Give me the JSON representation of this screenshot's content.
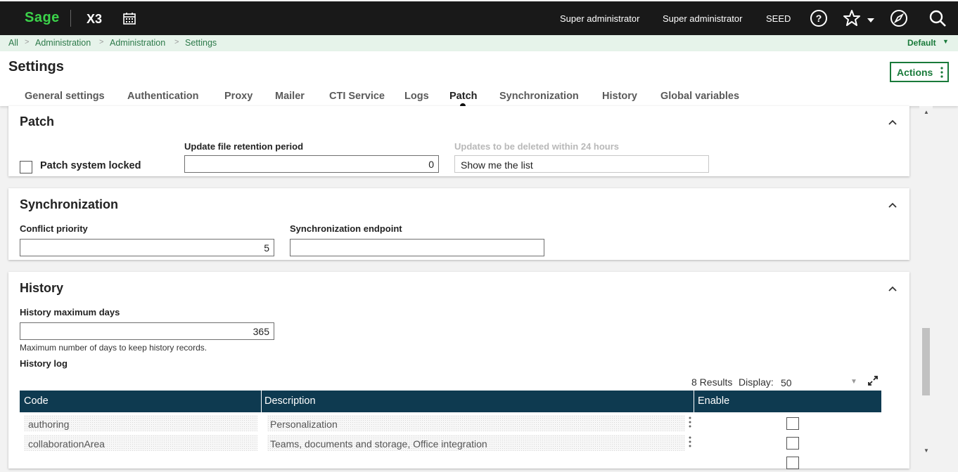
{
  "topbar": {
    "logo": "Sage",
    "product": "X3",
    "icons": [
      "calendar-icon",
      "help-icon",
      "star-icon",
      "compass-icon",
      "search-icon"
    ],
    "user": "Super administrator",
    "role": "Super administrator",
    "folder": "SEED",
    "accent_color": "#3bd34a",
    "background_color": "#191919"
  },
  "breadcrumb": {
    "items": [
      "All",
      "Administration",
      "Administration",
      "Settings"
    ],
    "separator": ">",
    "view": "Default"
  },
  "page": {
    "title": "Settings",
    "actions_label": "Actions",
    "brand_color": "#197a3a"
  },
  "tabs": [
    {
      "label": "General settings",
      "active": false
    },
    {
      "label": "Authentication",
      "active": false
    },
    {
      "label": "Proxy",
      "active": false
    },
    {
      "label": "Mailer",
      "active": false
    },
    {
      "label": "CTI Service",
      "active": false
    },
    {
      "label": "Logs",
      "active": false
    },
    {
      "label": "Patch",
      "active": true
    },
    {
      "label": "Synchronization",
      "active": false
    },
    {
      "label": "History",
      "active": false
    },
    {
      "label": "Global variables",
      "active": false
    }
  ],
  "patch": {
    "title": "Patch",
    "locked_label": "Patch system locked",
    "locked_checked": false,
    "retention_label": "Update file retention period",
    "retention_value": "0",
    "deleted_label": "Updates to be deleted within 24 hours",
    "deleted_value": "Show me the list"
  },
  "synchronization": {
    "title": "Synchronization",
    "priority_label": "Conflict priority",
    "priority_value": "5",
    "endpoint_label": "Synchronization endpoint",
    "endpoint_value": ""
  },
  "history": {
    "title": "History",
    "maxdays_label": "History maximum days",
    "maxdays_value": "365",
    "maxdays_help": "Maximum number of days to keep history records.",
    "log_label": "History log",
    "results": "8 Results",
    "display_label": "Display:",
    "display_value": "50",
    "header_color": "#0e3a50",
    "columns": [
      "Code",
      "Description",
      "Enable"
    ],
    "rows": [
      {
        "code": "authoring",
        "description": "Personalization",
        "enable": false
      },
      {
        "code": "collaborationArea",
        "description": "Teams, documents and storage, Office integration",
        "enable": false
      }
    ]
  }
}
